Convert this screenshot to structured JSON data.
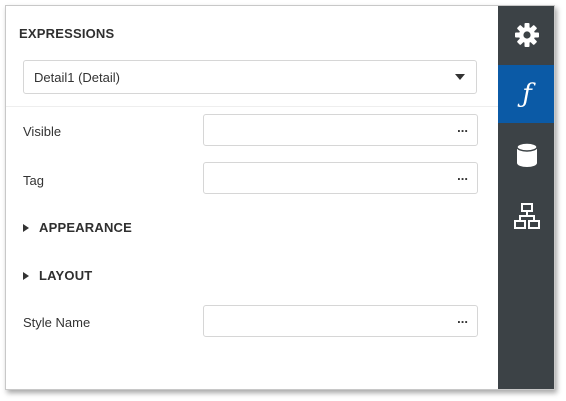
{
  "panel": {
    "section_title": "EXPRESSIONS",
    "selector": {
      "value": "Detail1 (Detail)"
    },
    "properties": [
      {
        "label": "Visible",
        "value": "",
        "button": "..."
      },
      {
        "label": "Tag",
        "value": "",
        "button": "..."
      }
    ],
    "groups": [
      {
        "label": "APPEARANCE",
        "expanded": false
      },
      {
        "label": "LAYOUT",
        "expanded": false
      }
    ],
    "style_name": {
      "label": "Style Name",
      "value": "",
      "button": "..."
    }
  },
  "sidebar": {
    "tabs": [
      {
        "icon": "gear-icon",
        "active": false
      },
      {
        "icon": "function-icon",
        "glyph": "ƒ",
        "active": true
      },
      {
        "icon": "database-icon",
        "active": false
      },
      {
        "icon": "hierarchy-icon",
        "active": false
      }
    ],
    "colors": {
      "background": "#3c4246",
      "active": "#0b5aa6"
    }
  }
}
